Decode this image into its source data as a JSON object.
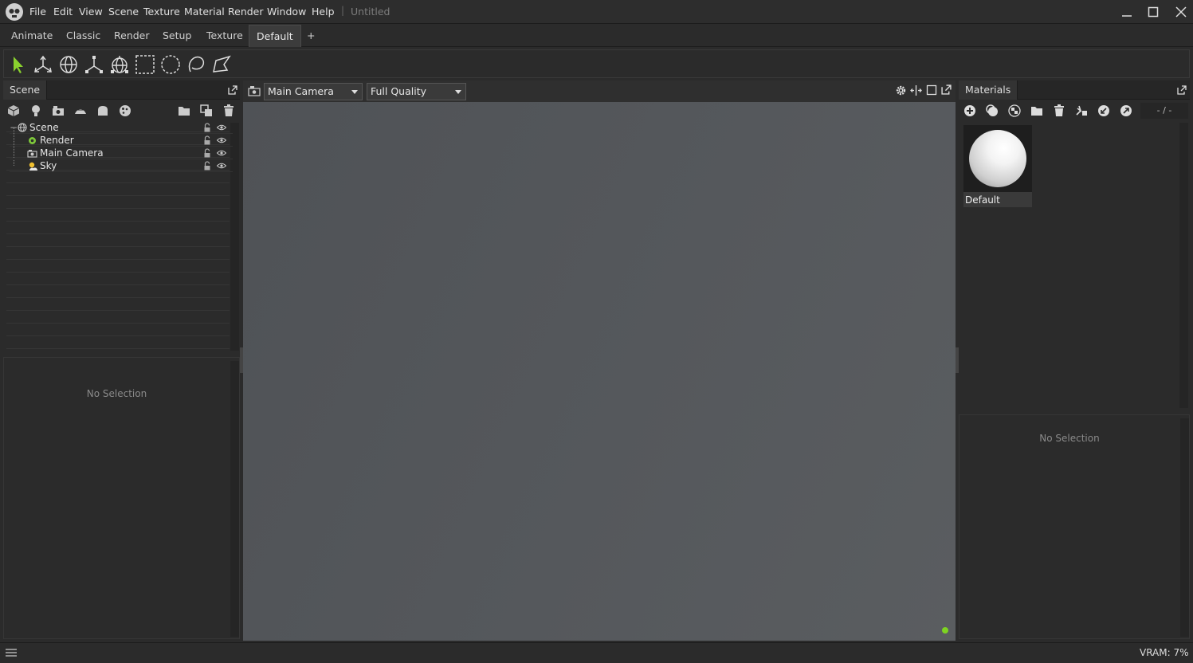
{
  "app": {
    "title": "Untitled",
    "separator": "|"
  },
  "menu": [
    "File",
    "Edit",
    "View",
    "Scene",
    "Texture",
    "Material",
    "Render",
    "Window",
    "Help"
  ],
  "workspace_tabs": [
    {
      "label": "Animate",
      "active": false
    },
    {
      "label": "Classic",
      "active": false
    },
    {
      "label": "Render",
      "active": false
    },
    {
      "label": "Setup",
      "active": false
    },
    {
      "label": "Texture",
      "active": false
    },
    {
      "label": "Default",
      "active": true
    }
  ],
  "add_tab_label": "+",
  "toolbar": {
    "tools": [
      "select-arrow-icon",
      "move-gizmo-icon",
      "rotate-gizmo-icon",
      "scale-gizmo-icon",
      "universal-gizmo-icon",
      "rect-select-icon",
      "circle-select-icon",
      "lasso-select-icon",
      "polygon-select-icon"
    ]
  },
  "scene_panel": {
    "title": "Scene",
    "tree": [
      {
        "label": "Scene",
        "level": 0,
        "icon": "scene-globe-icon"
      },
      {
        "label": "Render",
        "level": 1,
        "icon": "render-gear-icon"
      },
      {
        "label": "Main Camera",
        "level": 1,
        "icon": "camera-icon"
      },
      {
        "label": "Sky",
        "level": 1,
        "icon": "sky-sun-icon"
      }
    ],
    "inspector_empty": "No Selection"
  },
  "viewport": {
    "camera": "Main Camera",
    "quality": "Full Quality",
    "status_color": "#7ed321"
  },
  "materials_panel": {
    "title": "Materials",
    "counter": "- / -",
    "items": [
      {
        "label": "Default"
      }
    ],
    "inspector_empty": "No Selection"
  },
  "status": {
    "vram": "VRAM: 7%"
  },
  "colors": {
    "accent_green": "#8ad22e"
  }
}
